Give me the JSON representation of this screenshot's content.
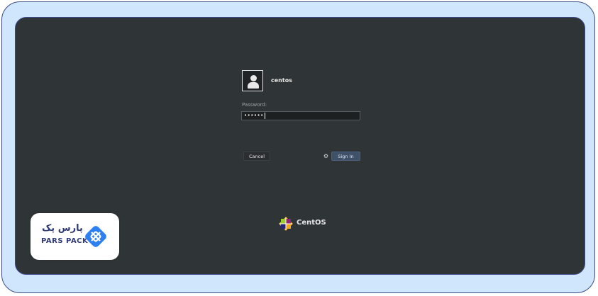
{
  "login": {
    "username": "centos",
    "password_label": "Password:",
    "password_value": "••••••",
    "cancel_label": "Cancel",
    "signin_label": "Sign In"
  },
  "footer": {
    "os_name": "CentOS"
  },
  "branding": {
    "name_fa": "پارس پک",
    "name_en": "PARS PACK"
  },
  "icons": {
    "avatar": "user-avatar-icon",
    "gear": "gear-icon",
    "centos": "centos-logo-icon",
    "brand": "parspack-logo-icon"
  },
  "colors": {
    "screen_bg": "#2f3437",
    "frame_bg": "#cfe6fc",
    "signin_bg": "#3e5167",
    "brand_blue": "#2e7ff0"
  }
}
